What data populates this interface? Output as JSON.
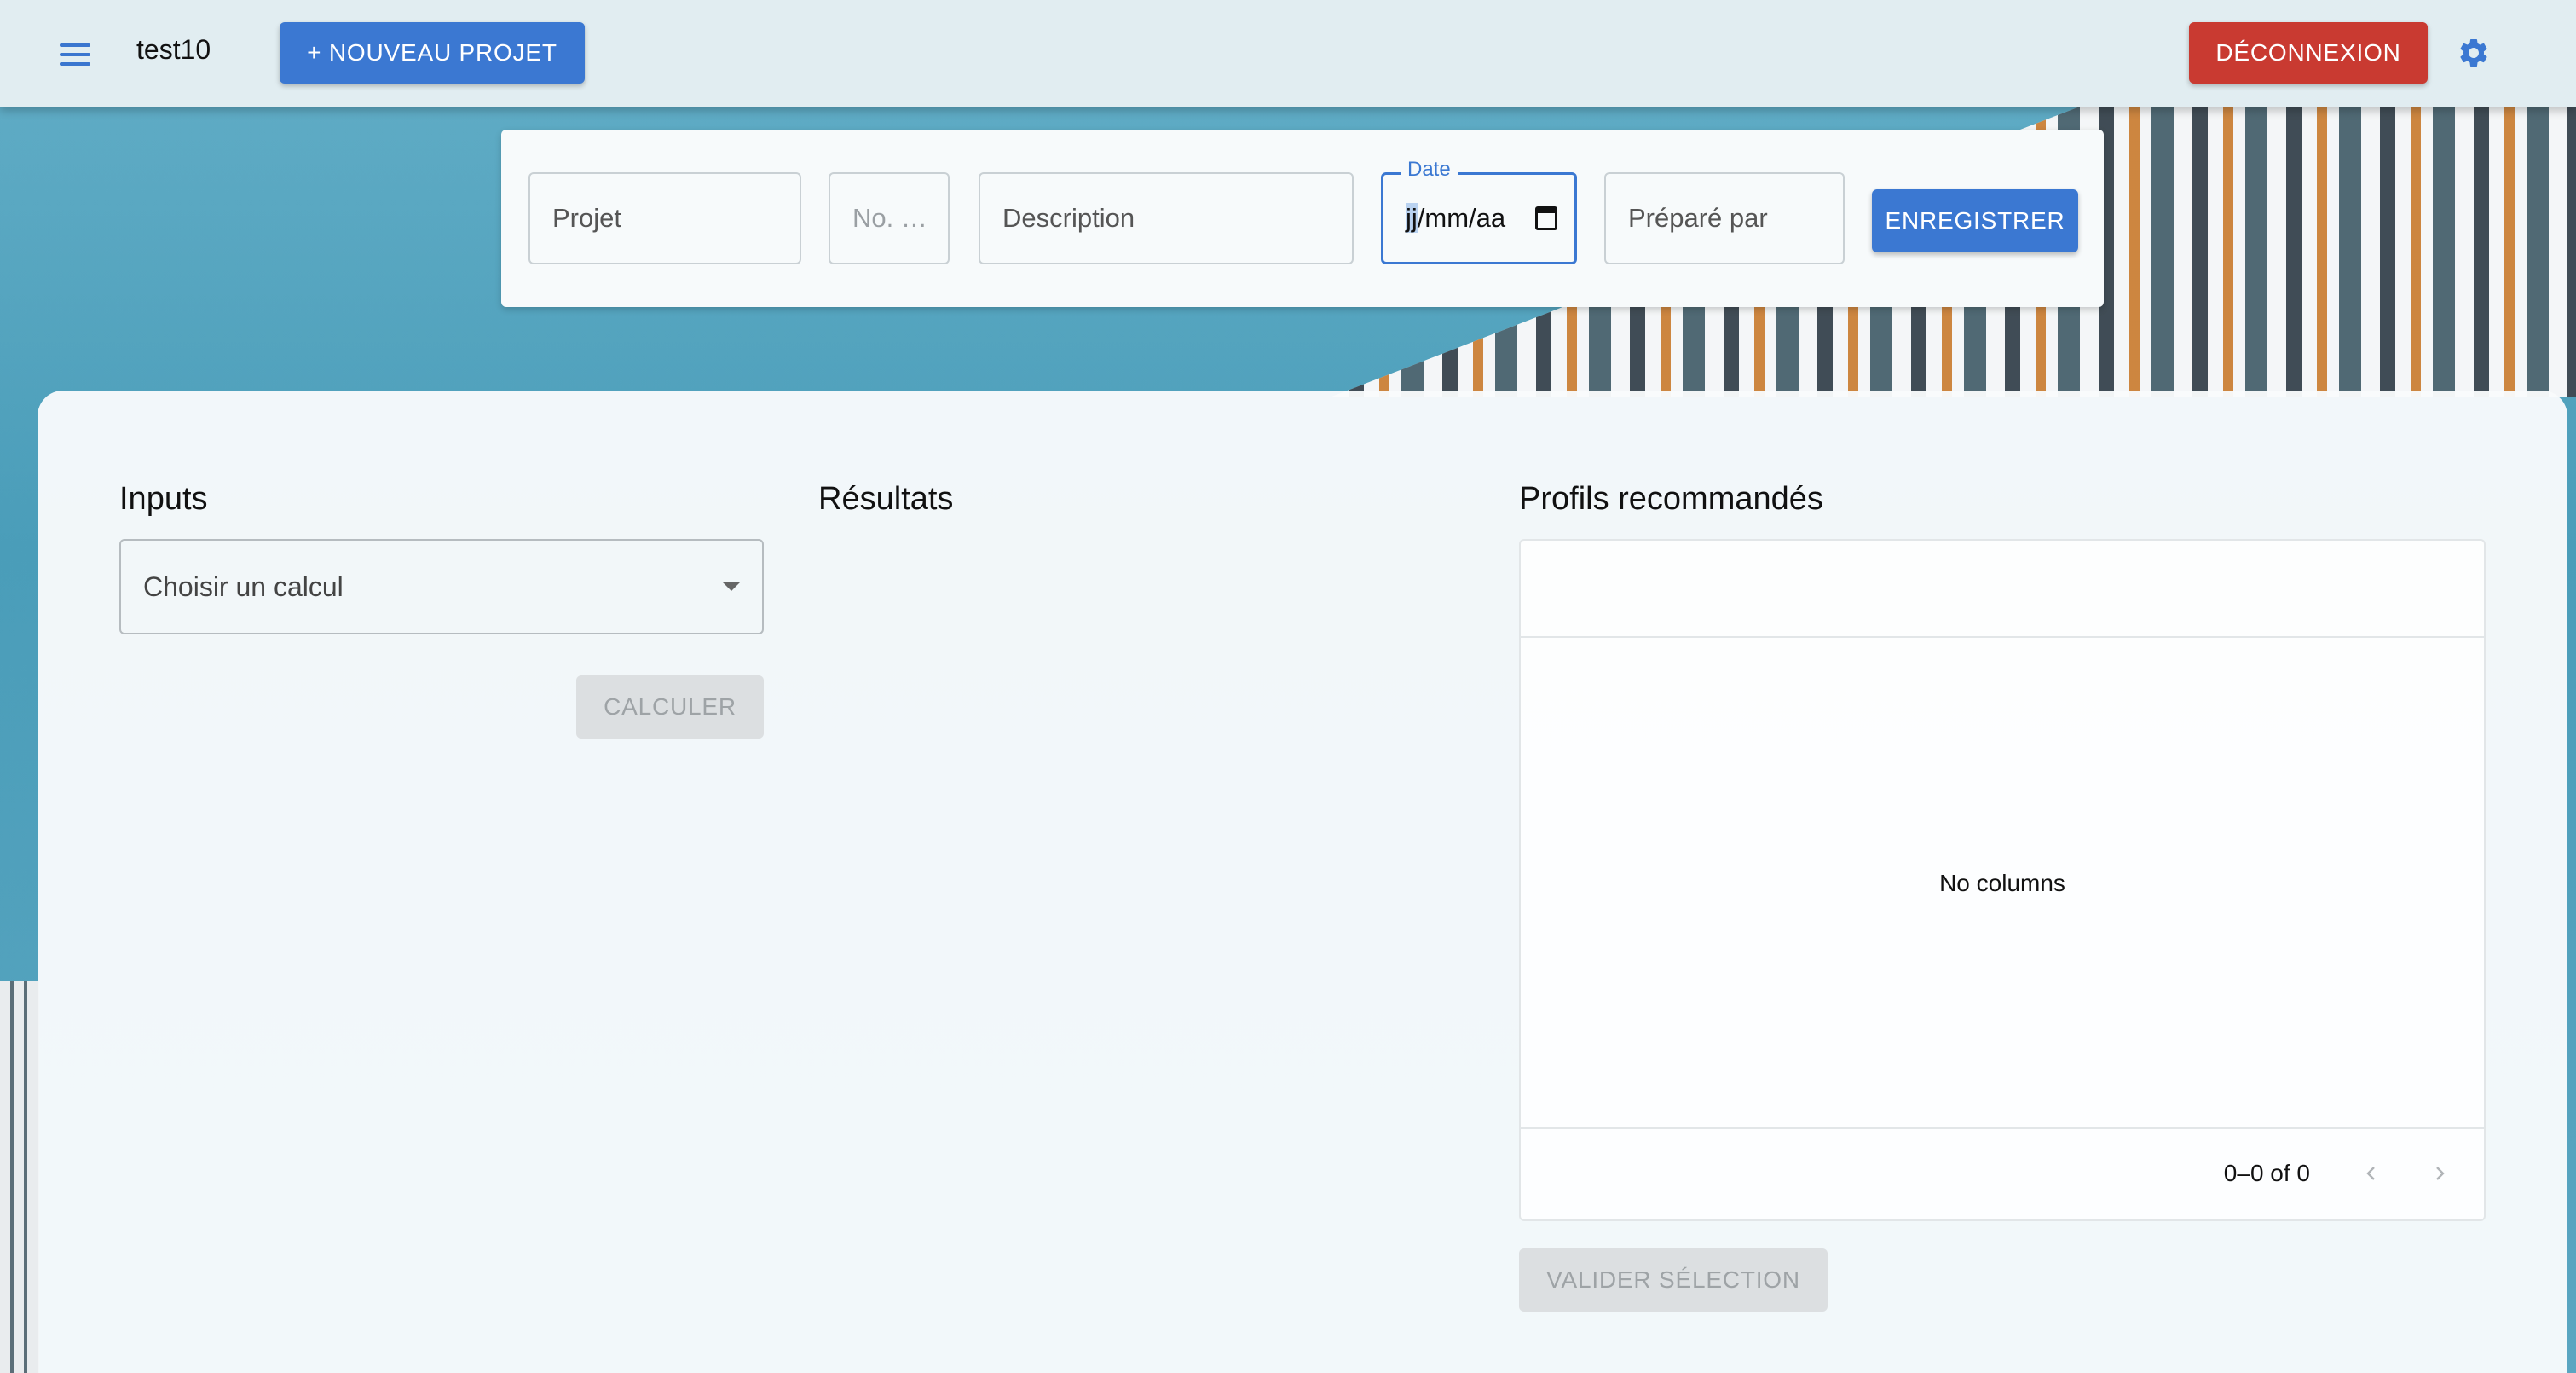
{
  "appbar": {
    "title": "test10",
    "new_project_label": "+ NOUVEAU PROJET",
    "logout_label": "DÉCONNEXION",
    "menu_icon": "hamburger-menu-icon",
    "settings_icon": "gear-icon"
  },
  "project_form": {
    "projet_placeholder": "Projet",
    "no_placeholder": "No. …",
    "description_placeholder": "Description",
    "date_label": "Date",
    "date_value_day": "jj",
    "date_value_rest": "/mm/aa",
    "prepare_placeholder": "Préparé par",
    "save_label": "ENREGISTRER"
  },
  "inputs": {
    "title": "Inputs",
    "select_placeholder": "Choisir un calcul",
    "calculate_label": "CALCULER"
  },
  "results": {
    "title": "Résultats"
  },
  "profiles": {
    "title": "Profils recommandés",
    "empty_text": "No columns",
    "pagination_text": "0–0 of 0",
    "validate_label": "VALIDER SÉLECTION"
  },
  "colors": {
    "primary": "#3b78d2",
    "danger": "#c93a31",
    "disabled_bg": "#dcdfe1",
    "disabled_text": "#9ea3a6"
  }
}
